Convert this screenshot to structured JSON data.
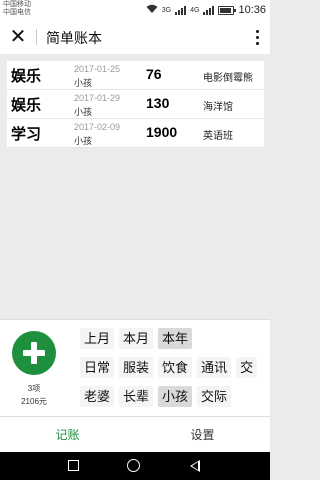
{
  "status_bar": {
    "carrier_1": "中国移动",
    "carrier_2": "中国电信",
    "net_1": "3G",
    "net_2": "4G",
    "time": "10:36",
    "battery_level": 0.85
  },
  "header": {
    "title": "简单账本",
    "close_icon": "close-icon",
    "more_icon": "more-vertical-icon"
  },
  "records": [
    {
      "category": "娱乐",
      "date": "2017-01-25",
      "person": "小孩",
      "amount": "76",
      "note": "电影倒霉熊"
    },
    {
      "category": "娱乐",
      "date": "2017-01-29",
      "person": "小孩",
      "amount": "130",
      "note": "海洋馆"
    },
    {
      "category": "学习",
      "date": "2017-02-09",
      "person": "小孩",
      "amount": "1900",
      "note": "英语班"
    }
  ],
  "summary": {
    "count": "3项",
    "total": "2106元",
    "add_icon": "plus-icon",
    "accent_color": "#1e8f3c"
  },
  "filters": {
    "period": [
      {
        "label": "上月",
        "selected": false
      },
      {
        "label": "本月",
        "selected": false
      },
      {
        "label": "本年",
        "selected": true
      }
    ],
    "category": [
      {
        "label": "日常",
        "selected": false
      },
      {
        "label": "服装",
        "selected": false
      },
      {
        "label": "饮食",
        "selected": false
      },
      {
        "label": "通讯",
        "selected": false
      },
      {
        "label": "交",
        "selected": false
      }
    ],
    "person": [
      {
        "label": "老婆",
        "selected": false
      },
      {
        "label": "长辈",
        "selected": false
      },
      {
        "label": "小孩",
        "selected": true
      },
      {
        "label": "交际",
        "selected": false
      }
    ]
  },
  "tabs": [
    {
      "label": "记账",
      "active": true
    },
    {
      "label": "设置",
      "active": false
    }
  ],
  "nav": {
    "recent_icon": "square-recent-icon",
    "home_icon": "circle-home-icon",
    "back_icon": "triangle-back-icon"
  }
}
